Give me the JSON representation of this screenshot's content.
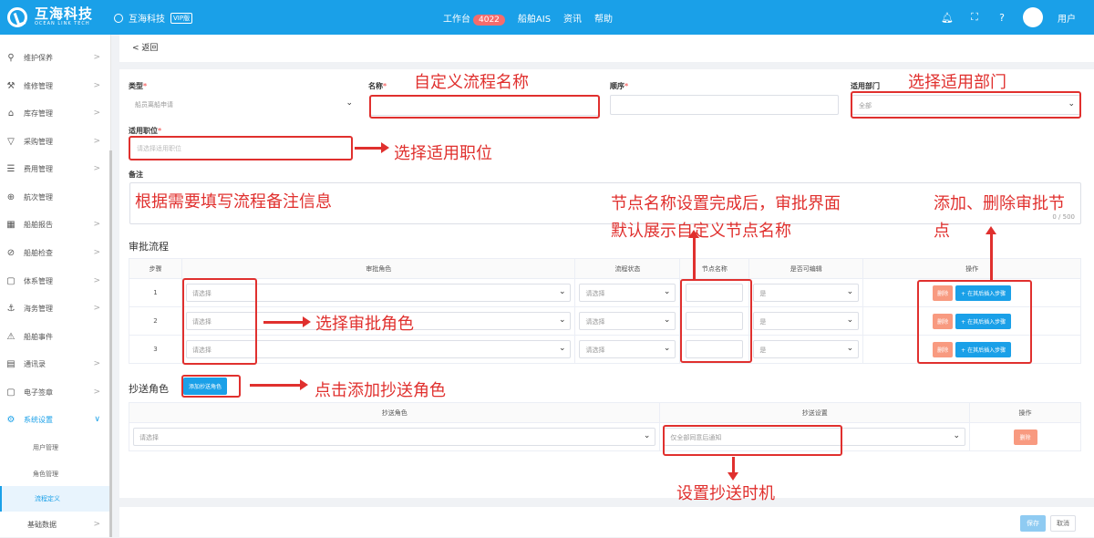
{
  "topbar": {
    "logo_cn": "互海科技",
    "logo_en": "OCEAN LINK TECH",
    "brand": "互海科技",
    "brand_tag": "VIP版",
    "menu": [
      {
        "label": "工作台",
        "badge": "4022"
      },
      {
        "label": "船舶AIS"
      },
      {
        "label": "资讯"
      },
      {
        "label": "帮助"
      }
    ],
    "user": "用户"
  },
  "sidebar": {
    "items": [
      {
        "label": "维护保养",
        "icon": "wrench-icon"
      },
      {
        "label": "维修管理",
        "icon": "tool-icon"
      },
      {
        "label": "库存管理",
        "icon": "home-icon"
      },
      {
        "label": "采购管理",
        "icon": "cart-icon"
      },
      {
        "label": "费用管理",
        "icon": "database-icon"
      },
      {
        "label": "航次管理",
        "icon": "globe-icon"
      },
      {
        "label": "船舶报告",
        "icon": "calendar-icon"
      },
      {
        "label": "船舶检查",
        "icon": "check-circle-icon"
      },
      {
        "label": "体系管理",
        "icon": "document-icon"
      },
      {
        "label": "海务管理",
        "icon": "anchor-icon"
      },
      {
        "label": "船舶事件",
        "icon": "warning-icon"
      },
      {
        "label": "通讯录",
        "icon": "contacts-icon"
      },
      {
        "label": "电子签章",
        "icon": "stamp-icon"
      },
      {
        "label": "系统设置",
        "icon": "gear-icon"
      }
    ],
    "sub_items": [
      {
        "label": "用户管理"
      },
      {
        "label": "角色管理"
      },
      {
        "label": "流程定义"
      },
      {
        "label": "基础数据"
      }
    ]
  },
  "page": {
    "back": "< 返回",
    "type_label": "类型",
    "type_value": "船员离船申请",
    "name_label": "名称",
    "order_label": "顺序",
    "dept_label": "适用部门",
    "dept_value": "全部",
    "position_label": "适用职位",
    "position_placeholder": "请选择适用职位",
    "remark_label": "备注",
    "remark_counter": "0 / 500",
    "approval_title": "审批流程",
    "approval_headers": [
      "步骤",
      "审批角色",
      "流程状态",
      "节点名称",
      "是否可编辑",
      "操作"
    ],
    "approval_rows": [
      {
        "step": "1",
        "role": "请选择",
        "status": "请选择",
        "editable": "是"
      },
      {
        "step": "2",
        "role": "请选择",
        "status": "请选择",
        "editable": "是"
      },
      {
        "step": "3",
        "role": "请选择",
        "status": "请选择",
        "editable": "是"
      }
    ],
    "delete_label": "删除",
    "insert_label": "+ 在其后插入步骤",
    "cc_title": "抄送角色",
    "cc_add_button": "添加抄送角色",
    "cc_headers": [
      "抄送角色",
      "抄送设置",
      "操作"
    ],
    "cc_row": {
      "role": "请选择",
      "setting": "仅全部同意后通知",
      "delete": "删除"
    },
    "save": "保存",
    "cancel": "取消"
  },
  "annotations": {
    "custom_name": "自定义流程名称",
    "select_dept": "选择适用部门",
    "select_position": "选择适用职位",
    "remark_hint": "根据需要填写流程备注信息",
    "node_name_line1": "节点名称设置完成后，审批界面",
    "node_name_line2": "默认展示自定义节点名称",
    "add_delete_line1": "添加、删除审批节",
    "add_delete_line2": "点",
    "select_role": "选择审批角色",
    "add_cc": "点击添加抄送角色",
    "set_cc_time": "设置抄送时机"
  },
  "colors": {
    "topbar": "#1aa0e8",
    "annotation": "#e0302e"
  }
}
